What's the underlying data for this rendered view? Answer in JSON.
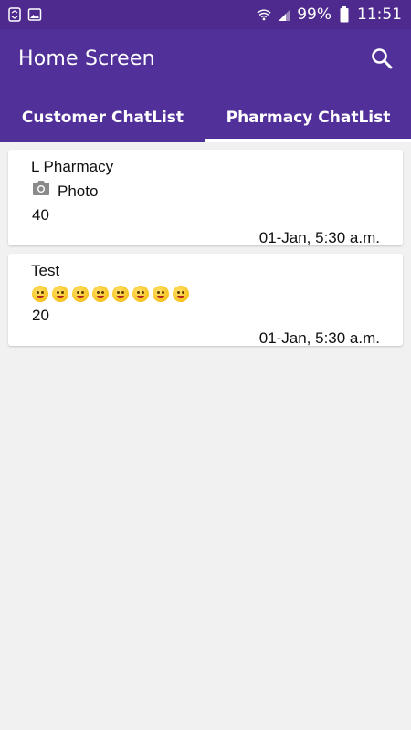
{
  "status_bar": {
    "battery": "99%",
    "time": "11:51",
    "icons": [
      "screenshot-icon",
      "image-icon",
      "wifi-icon",
      "signal-icon",
      "battery-icon"
    ]
  },
  "app_bar": {
    "title": "Home Screen",
    "search_icon": "search-icon"
  },
  "tabs": [
    {
      "label": "Customer ChatList",
      "selected": false
    },
    {
      "label": "Pharmacy ChatList",
      "selected": true
    }
  ],
  "chats": [
    {
      "name": "L Pharmacy",
      "message_icon": "camera-icon",
      "message": "Photo",
      "count": "40",
      "time": "01-Jan, 5:30 a.m."
    },
    {
      "name": "Test",
      "emojis": [
        "emoji-1",
        "emoji-2",
        "emoji-3",
        "emoji-4",
        "emoji-5",
        "emoji-6",
        "emoji-7",
        "emoji-8"
      ],
      "count": "20",
      "time": "01-Jan, 5:30 a.m."
    }
  ],
  "colors": {
    "primary": "#52309a",
    "status_bar": "#4e2a8e",
    "background": "#f1f1f1"
  }
}
